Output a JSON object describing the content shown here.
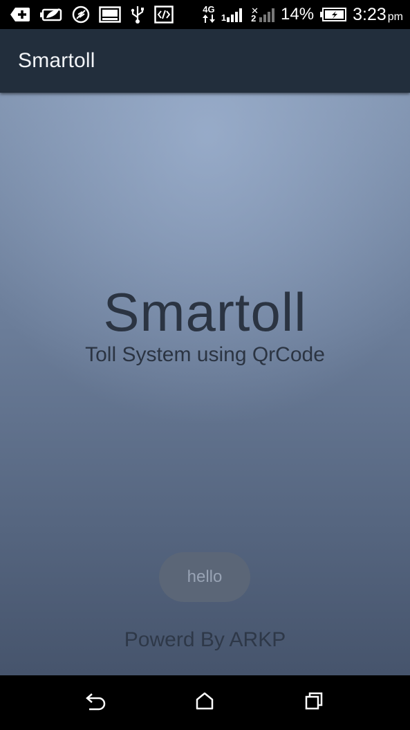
{
  "status_bar": {
    "icons": [
      "add-box-icon",
      "battery-saver-icon",
      "feather-icon",
      "image-icon",
      "usb-icon",
      "code-icon"
    ],
    "network_type": "4G",
    "sim1": "1",
    "sim2": "2",
    "battery_percent": "14%",
    "time": "3:23",
    "ampm": "pm"
  },
  "app_bar": {
    "title": "Smartoll"
  },
  "main": {
    "title": "Smartoll",
    "subtitle": "Toll System using QrCode",
    "button_label": "hello",
    "footer": "Powerd By ARKP"
  },
  "nav_bar": {
    "icons": [
      "back-icon",
      "home-icon",
      "recents-icon"
    ]
  },
  "colors": {
    "app_bar": "#222e3c",
    "content_top": "#7f92ae",
    "content_bottom": "#46546c",
    "text_dark": "#2b3442",
    "button_bg": "#5b6677",
    "button_text": "#98a3b4"
  }
}
